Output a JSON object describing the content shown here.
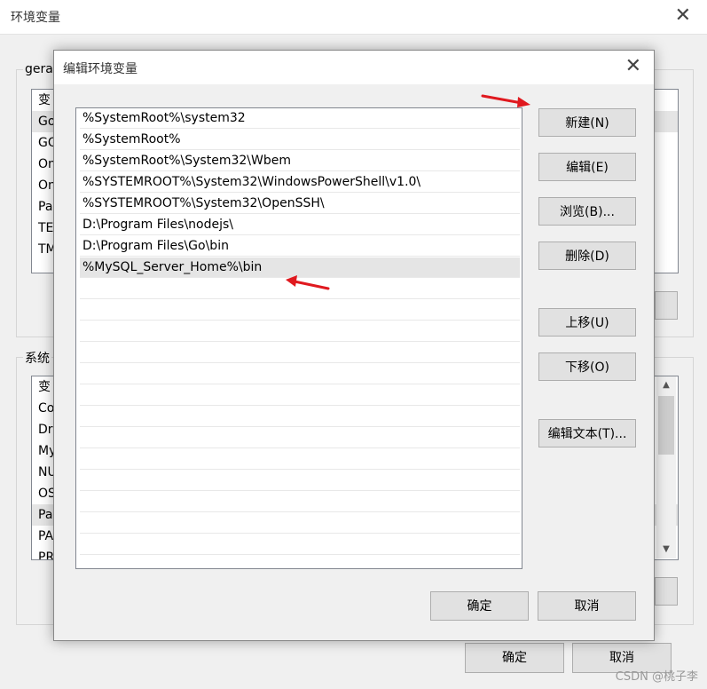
{
  "background_window": {
    "title": "环境变量",
    "user_group_label": "gera",
    "user_rows": [
      "变",
      "Go",
      "GO",
      "On",
      "On",
      "Pa",
      "TE",
      "TM"
    ],
    "system_group_label": "系统",
    "system_rows": [
      "变",
      "Co",
      "Dr",
      "My",
      "NU",
      "OS",
      "Pa",
      "PA",
      "PR"
    ],
    "ok_label": "确定",
    "cancel_label": "取消"
  },
  "edit_dialog": {
    "title": "编辑环境变量",
    "paths": [
      "%SystemRoot%\\system32",
      "%SystemRoot%",
      "%SystemRoot%\\System32\\Wbem",
      "%SYSTEMROOT%\\System32\\WindowsPowerShell\\v1.0\\",
      "%SYSTEMROOT%\\System32\\OpenSSH\\",
      "D:\\Program Files\\nodejs\\",
      "D:\\Program Files\\Go\\bin",
      "%MySQL_Server_Home%\\bin"
    ],
    "selected_index": 7,
    "buttons": {
      "new": "新建(N)",
      "edit": "编辑(E)",
      "browse": "浏览(B)...",
      "delete": "删除(D)",
      "move_up": "上移(U)",
      "move_down": "下移(O)",
      "edit_text": "编辑文本(T)..."
    },
    "ok_label": "确定",
    "cancel_label": "取消"
  },
  "watermark": "CSDN @桃子李",
  "colors": {
    "annotation_arrow": "#e0191f",
    "selection": "#e5e5e5",
    "button_face": "#e1e1e1"
  }
}
